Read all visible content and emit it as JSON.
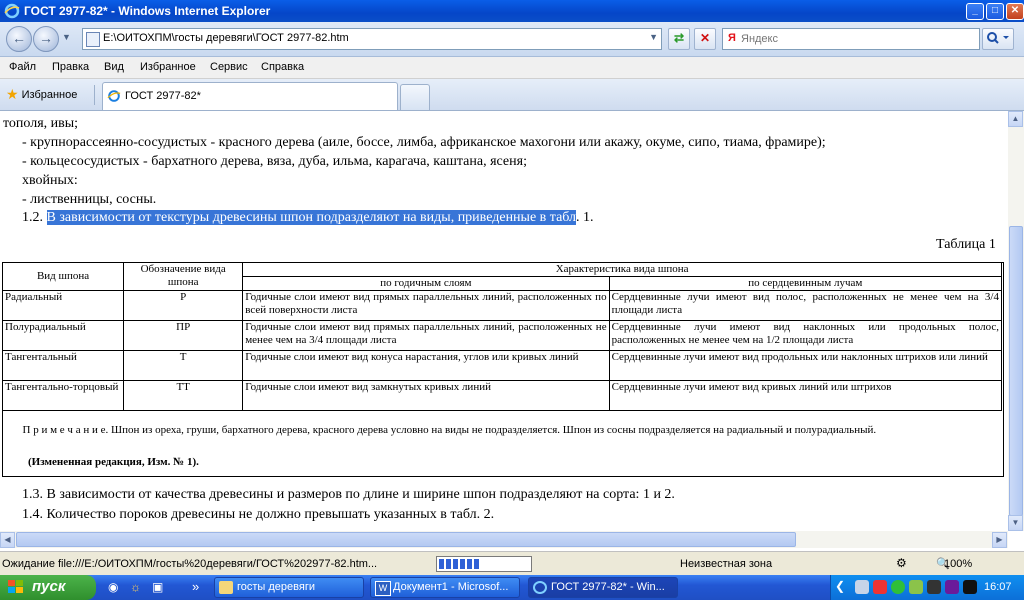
{
  "window": {
    "title": "ГОСТ 2977-82* - Windows Internet Explorer",
    "min": "_",
    "max": "□",
    "close": "✕"
  },
  "address": {
    "url": "E:\\ОИТОХПМ\\госты деревяги\\ГОСТ 2977-82.htm"
  },
  "search": {
    "engine": "Я",
    "placeholder": "Яндекс"
  },
  "menu": [
    "Файл",
    "Правка",
    "Вид",
    "Избранное",
    "Сервис",
    "Справка"
  ],
  "favorites_label": "Избранное",
  "tab": {
    "label": "ГОСТ 2977-82*"
  },
  "doc": {
    "line1": "тополя, ивы;",
    "line2": "- крупнорассеянно-сосудистых - красного дерева (аиле, боссе, лимба, африканское махогони или акажу, окуме, сипо, тиама, фрамире);",
    "line3": "- кольцесосудистых - бархатного дерева, вяза, дуба, ильма, карагача, каштана, ясеня;",
    "line4": "хвойных:",
    "line5": "- лиственницы, сосны.",
    "p12_num": "1.2.",
    "p12_sel": "В зависимости от текстуры древесины шпон подразделяют на виды, приведенные в табл",
    "p12_end": ". 1.",
    "table_caption": "Таблица 1",
    "p13": "1.3. В зависимости от качества древесины и размеров по длине и ширине шпон подразделяют на сорта: 1 и 2.",
    "p14": "1.4. Количество пороков древесины не должно превышать указанных в табл. 2."
  },
  "table": {
    "h_kind": "Вид шпона",
    "h_code": "Обозначение вида шпона",
    "h_char": "Характеристика вида шпона",
    "h_annual": "по годичным слоям",
    "h_rays": "по сердцевинным лучам",
    "rows": [
      {
        "kind": "Радиальный",
        "code": "Р",
        "annual": "Годичные слои имеют вид прямых параллельных линий, расположенных по всей поверхности листа",
        "rays": "Сердцевинные лучи имеют вид полос, расположенных не менее чем на 3/4 площади листа"
      },
      {
        "kind": "Полурадиальный",
        "code": "ПР",
        "annual": "Годичные слои имеют вид прямых параллельных линий, расположенных не менее чем на 3/4 площади листа",
        "rays": "Сердцевинные лучи имеют вид наклонных или продольных полос, расположенных не менее чем на 1/2 площади листа"
      },
      {
        "kind": "Тангентальный",
        "code": "Т",
        "annual": "Годичные слои имеют вид конуса нарастания, углов или кривых линий",
        "rays": "Сердцевинные лучи имеют вид продольных или наклонных штрихов или линий"
      },
      {
        "kind": "Тангентально-торцовый",
        "code": "ТТ",
        "annual": "Годичные слои имеют вид замкнутых кривых линий",
        "rays": "Сердцевинные лучи имеют вид кривых линий или штрихов"
      }
    ],
    "note_label": "П р и м е ч а н и е.",
    "note": "Шпон из ореха, груши, бархатного дерева, красного дерева условно на виды не подразделяется. Шпон из сосны подразделяется на радиальный и полурадиальный.",
    "note_bold": "(Измененная редакция, Изм. № 1)."
  },
  "status": {
    "text": "Ожидание file:///E:/ОИТОХПМ/госты%20деревяги/ГОСТ%202977-82.htm...",
    "progress": 0.45,
    "zone": "Неизвестная зона",
    "zoom": "100%"
  },
  "taskbar": {
    "start": "пуск",
    "arrows": "»",
    "items": [
      {
        "label": "госты деревяги"
      },
      {
        "label": "Документ1 - Microsof..."
      },
      {
        "label": "ГОСТ 2977-82* - Win..."
      }
    ],
    "clock": "16:07"
  },
  "colors": {
    "selection": "#3875d7",
    "titlebar": "#0a5ee8",
    "taskbar": "#2257d4",
    "start": "#3c9f3a"
  }
}
